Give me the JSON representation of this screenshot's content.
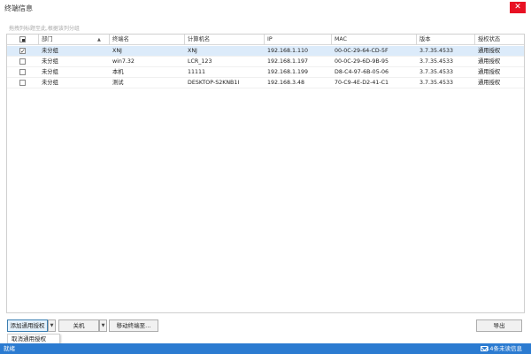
{
  "window": {
    "title": "终端信息",
    "close_symbol": "✕"
  },
  "group_hint": "拖拽列标题至此,根据该列分组",
  "table": {
    "columns": [
      "部门",
      "终端名",
      "计算机名",
      "IP",
      "MAC",
      "版本",
      "授权状态"
    ],
    "sort_indicator": "▲",
    "rows": [
      {
        "checked": true,
        "selected": true,
        "cells": [
          "未分组",
          "XNJ",
          "XNJ",
          "192.168.1.110",
          "00-0C-29-64-CD-5F",
          "3.7.35.4533",
          "通用授权"
        ]
      },
      {
        "checked": false,
        "selected": false,
        "cells": [
          "未分组",
          "win7.32",
          "LCR_123",
          "192.168.1.197",
          "00-0C-29-6D-9B-95",
          "3.7.35.4533",
          "通用授权"
        ]
      },
      {
        "checked": false,
        "selected": false,
        "cells": [
          "未分组",
          "本机",
          "11111",
          "192.168.1.199",
          "D8-C4-97-6B-05-06",
          "3.7.35.4533",
          "通用授权"
        ]
      },
      {
        "checked": false,
        "selected": false,
        "cells": [
          "未分组",
          "测试",
          "DESKTOP-S2KNB1I",
          "192.168.3.48",
          "70-C9-4E-D2-41-C1",
          "3.7.35.4533",
          "通用授权"
        ]
      }
    ],
    "check_mark": "✓"
  },
  "buttons": {
    "add_license": "添加通用授权",
    "shutdown": "关机",
    "move_terminal": "移动终端至...",
    "export": "导出",
    "dropdown_arrow": "▼"
  },
  "dropdown": {
    "cancel_license": "取消通用授权"
  },
  "status": {
    "left": "就绪",
    "unread": "14条未读信息"
  },
  "colors": {
    "accent": "#2b7bd1",
    "selected_row": "#dcebfa",
    "close": "#e81123"
  }
}
